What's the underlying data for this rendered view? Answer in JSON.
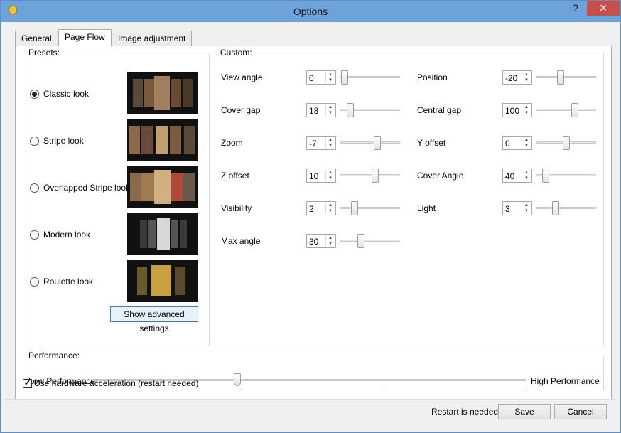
{
  "window": {
    "title": "Options",
    "help": "?",
    "close": "✕"
  },
  "tabs": [
    {
      "label": "General"
    },
    {
      "label": "Page Flow"
    },
    {
      "label": "Image adjustment"
    }
  ],
  "presets": {
    "legend": "Presets:",
    "items": [
      {
        "label": "Classic look",
        "checked": true
      },
      {
        "label": "Stripe look",
        "checked": false
      },
      {
        "label": "Overlapped Stripe look",
        "checked": false
      },
      {
        "label": "Modern look",
        "checked": false
      },
      {
        "label": "Roulette look",
        "checked": false
      }
    ],
    "advanced_button": "Show advanced settings"
  },
  "custom": {
    "legend": "Custom:",
    "left": [
      {
        "label": "View angle",
        "value": "0"
      },
      {
        "label": "Cover gap",
        "value": "18"
      },
      {
        "label": "Zoom",
        "value": "-7"
      },
      {
        "label": "Z offset",
        "value": "10"
      },
      {
        "label": "Visibility",
        "value": "2"
      },
      {
        "label": "Max angle",
        "value": "30"
      }
    ],
    "right": [
      {
        "label": "Position",
        "value": "-20"
      },
      {
        "label": "Central gap",
        "value": "100"
      },
      {
        "label": "Y offset",
        "value": "0"
      },
      {
        "label": "Cover Angle",
        "value": "40"
      },
      {
        "label": "Light",
        "value": "3"
      }
    ]
  },
  "performance": {
    "legend": "Performance:",
    "low_label": "Low Performance",
    "high_label": "High Performance"
  },
  "hw_accel": {
    "label": "Use hardware acceleration (restart needed)",
    "checked": true
  },
  "footer": {
    "status": "Restart is needed",
    "save": "Save",
    "cancel": "Cancel"
  }
}
